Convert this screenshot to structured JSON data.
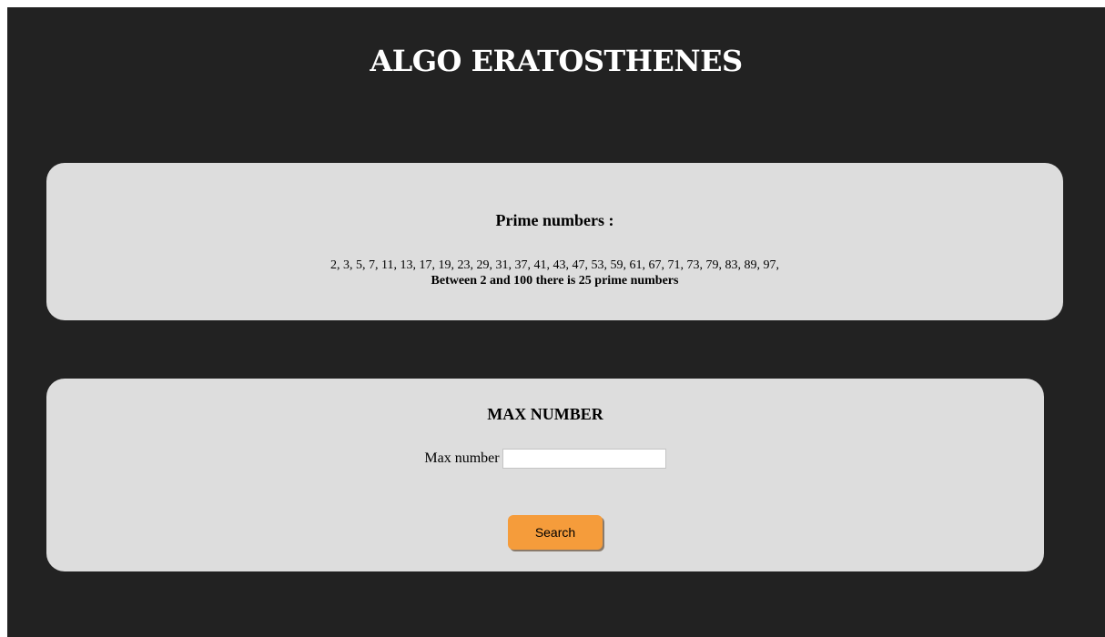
{
  "header": {
    "title": "ALGO ERATOSTHENES"
  },
  "results": {
    "heading": "Prime numbers :",
    "primes_text": "2, 3, 5, 7, 11, 13, 17, 19, 23, 29, 31, 37, 41, 43, 47, 53, 59, 61, 67, 71, 73, 79, 83, 89, 97,",
    "summary": "Between 2 and 100 there is 25 prime numbers"
  },
  "form": {
    "heading": "MAX NUMBER",
    "max_label": "Max number",
    "max_value": "",
    "search_label": "Search"
  },
  "colors": {
    "page_background": "#222222",
    "panel_background": "#dddddd",
    "button_accent": "#f59c3b",
    "title_text": "#ffffff"
  }
}
